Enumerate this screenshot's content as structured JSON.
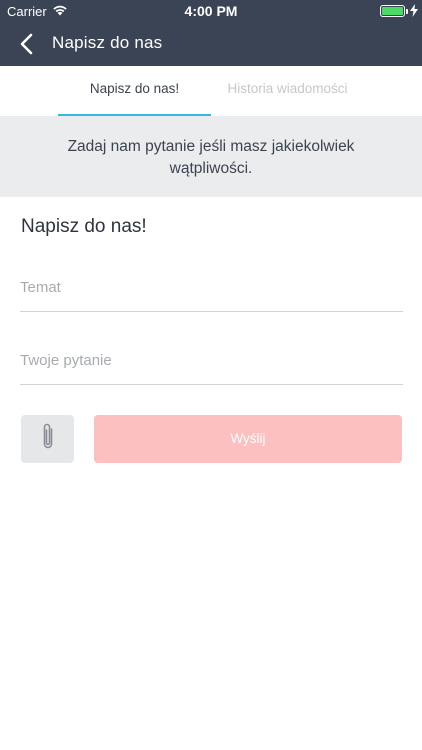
{
  "status_bar": {
    "carrier": "Carrier",
    "time": "4:00 PM",
    "battery_color": "#4cd964"
  },
  "nav": {
    "back_icon": "chevron-left-icon",
    "title": "Napisz do nas"
  },
  "tabs": [
    {
      "label": "Napisz do nas!",
      "active": true
    },
    {
      "label": "Historia wiadomości",
      "active": false
    }
  ],
  "banner": {
    "line1": "Zadaj nam pytanie jeśli masz jakiekolwiek",
    "line2": "wątpliwości."
  },
  "form": {
    "title": "Napisz do nas!",
    "subject_placeholder": "Temat",
    "subject_value": "",
    "question_placeholder": "Twoje pytanie",
    "question_value": "",
    "attach_icon": "paperclip-icon",
    "send_label": "Wyślij"
  },
  "colors": {
    "header_bg": "#3b4454",
    "tab_underline": "#35b6e4",
    "banner_bg": "#ebecee",
    "send_button_bg": "#fdc0c0"
  }
}
